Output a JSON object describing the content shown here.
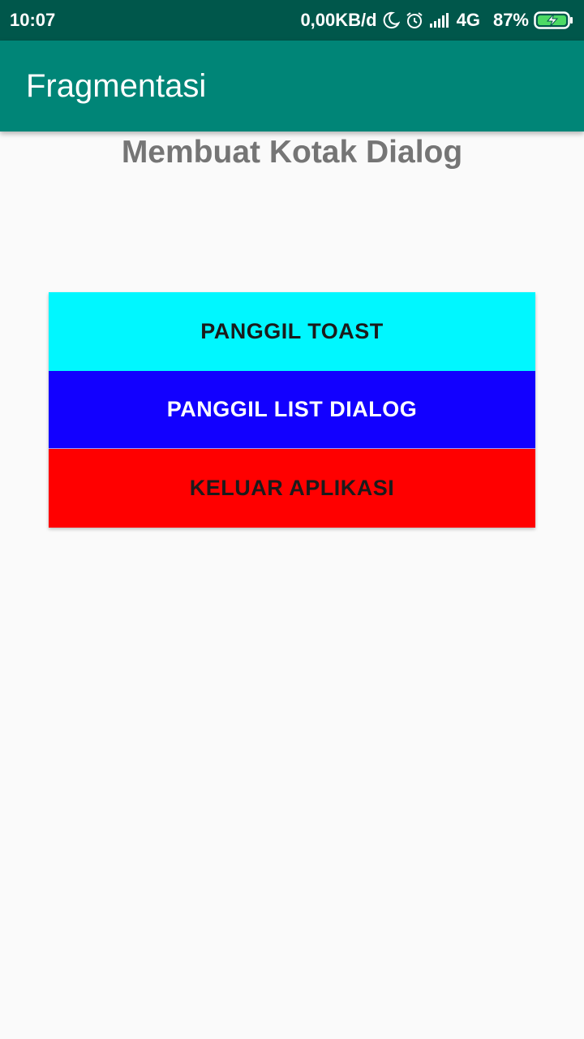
{
  "status_bar": {
    "time": "10:07",
    "network_speed": "0,00KB/d",
    "network_type": "4G",
    "battery_percent": "87%",
    "icons": [
      "moon-icon",
      "alarm-icon",
      "signal-icon",
      "battery-charging-icon"
    ]
  },
  "app_bar": {
    "title": "Fragmentasi"
  },
  "main": {
    "heading": "Membuat Kotak Dialog",
    "buttons": [
      {
        "label": "PANGGIL TOAST",
        "color": "#00f7ff"
      },
      {
        "label": "PANGGIL LIST DIALOG",
        "color": "#1200ff"
      },
      {
        "label": "KELUAR APLIKASI",
        "color": "#ff0000"
      }
    ]
  },
  "colors": {
    "status_bar": "#00574b",
    "primary": "#008577",
    "background": "#fafafa"
  }
}
